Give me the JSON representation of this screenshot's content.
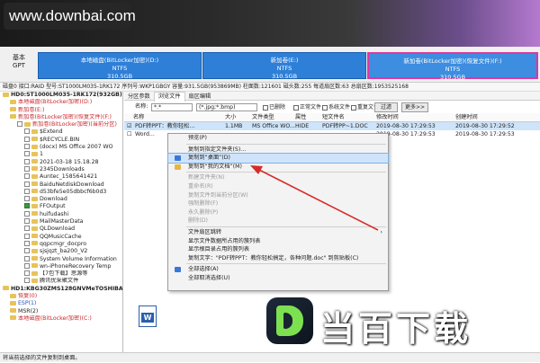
{
  "watermark": "www.downbai.com",
  "disk": {
    "label1": "基本",
    "label2": "GPT",
    "partitions": [
      {
        "name": "本地磁盘(BitLocker加密)(D:)",
        "fs": "NTFS",
        "size": "310.5GB"
      },
      {
        "name": "新加卷(E:)",
        "fs": "NTFS",
        "size": "310.5GB"
      },
      {
        "name": "新加卷(BitLocker加密)(恢复文件)(F:)",
        "fs": "NTFS",
        "size": "310.5GB"
      }
    ]
  },
  "infobar": "磁盘0 接口:RAID  型号:ST1000LM035-1RK172  序列号:WKP1GBGY  容量:931.5GB(953869MB)  柱面数:121601  磁头数:255  每道扇区数:63  总扇区数:1953525168",
  "tree": [
    {
      "text": "HD0:ST1000LM035-1RK172(932GB)",
      "cls": "bold",
      "indent": 0
    },
    {
      "text": "本地磁盘(BitLocker加密)(D:)",
      "cls": "red",
      "indent": 1
    },
    {
      "text": "新加卷(E:)",
      "cls": "red",
      "indent": 1
    },
    {
      "text": "新加卷(BitLocker加密)(恢复文件)(F:)",
      "cls": "red",
      "indent": 1
    },
    {
      "text": "新加卷(BitLocker加密)(当前分区)",
      "cls": "red",
      "indent": 2
    },
    {
      "text": "$Extend",
      "cls": "",
      "indent": 3
    },
    {
      "text": "$RECYCLE.BIN",
      "cls": "",
      "indent": 3
    },
    {
      "text": "(docx) MS Office 2007 WO",
      "cls": "",
      "indent": 3
    },
    {
      "text": "1",
      "cls": "",
      "indent": 3
    },
    {
      "text": "2021-03-18 15.18.28",
      "cls": "",
      "indent": 3
    },
    {
      "text": "2345Downloads",
      "cls": "",
      "indent": 3
    },
    {
      "text": "Auntec_1585641421",
      "cls": "",
      "indent": 3
    },
    {
      "text": "BaiduNetdiskDownload",
      "cls": "",
      "indent": 3
    },
    {
      "text": "d53bfe5e05dbbcf6b0d3",
      "cls": "",
      "indent": 3
    },
    {
      "text": "Download",
      "cls": "",
      "indent": 3
    },
    {
      "text": "FFOutput",
      "cls": "",
      "indent": 3,
      "checked": true
    },
    {
      "text": "huifudashi",
      "cls": "",
      "indent": 3
    },
    {
      "text": "MailMasterData",
      "cls": "",
      "indent": 3
    },
    {
      "text": "QLDownload",
      "cls": "",
      "indent": 3
    },
    {
      "text": "QQMusicCache",
      "cls": "",
      "indent": 3
    },
    {
      "text": "qqpcmgr_docpro",
      "cls": "",
      "indent": 3
    },
    {
      "text": "sjsjqzt_ba200_V2",
      "cls": "",
      "indent": 3
    },
    {
      "text": "System Volume Information",
      "cls": "",
      "indent": 3
    },
    {
      "text": "wn-iPhoneRecovery Temp",
      "cls": "",
      "indent": 3
    },
    {
      "text": "【7包下载】思源等",
      "cls": "",
      "indent": 3
    },
    {
      "text": "腾讯优采聚文件",
      "cls": "",
      "indent": 3
    },
    {
      "text": "HD1:KBG30ZMS128GNVMeTOSHIBA1",
      "cls": "bold",
      "indent": 0
    },
    {
      "text": "恢复(0)",
      "cls": "red",
      "indent": 1
    },
    {
      "text": "ESP(1)",
      "cls": "blue",
      "indent": 1
    },
    {
      "text": "MSR(2)",
      "cls": "",
      "indent": 1
    },
    {
      "text": "本地磁盘(BitLocker加密)(C:)",
      "cls": "red",
      "indent": 1
    }
  ],
  "tabs": [
    "分区参数",
    "浏览文件",
    "扇区编辑"
  ],
  "filter": {
    "name_label": "名称:",
    "name_value": "*.*",
    "type_value": "(*.jpg;*.bmp)",
    "deleted": "已删除",
    "normal": "正常文件",
    "system": "系统文件",
    "dup": "重复文件",
    "filter_btn": "过滤",
    "more_btn": "更多>>"
  },
  "columns": [
    "名称",
    "大小",
    "文件类型",
    "属性",
    "短文件名",
    "修改时间",
    "创建时间"
  ],
  "files": [
    {
      "name": "PDF转PPT：教你轻松...",
      "size": "1.1MB",
      "type": "MS Office WO...",
      "attr": "HIDE",
      "short": "PDF转PP~1.DOC",
      "mtime": "2019-08-30 17:29:53",
      "ctime": "2019-08-30 17:29:52"
    },
    {
      "name": "Word...",
      "size": "",
      "type": "",
      "attr": "",
      "short": "",
      "mtime": "2019-08-30 17:29:53",
      "ctime": "2019-08-30 17:29:53"
    }
  ],
  "menu": [
    {
      "label": "预览(P)",
      "dis": false
    },
    {
      "sep": true
    },
    {
      "label": "复制到指定文件夹(S)...",
      "dis": false
    },
    {
      "label": "复制到“桌面”(D)",
      "dis": false,
      "hl": true,
      "icon": "#3b77d8"
    },
    {
      "label": "复制到“我的文档”(M)",
      "dis": false,
      "icon": "#e6b640"
    },
    {
      "sep": true
    },
    {
      "label": "新建文件夹(N)",
      "dis": true
    },
    {
      "label": "重命名(R)",
      "dis": true
    },
    {
      "label": "复制文件到当前分区(W)",
      "dis": true
    },
    {
      "label": "强制删除(F)",
      "dis": true
    },
    {
      "label": "永久删除(P)",
      "dis": true
    },
    {
      "label": "删除(D)",
      "dis": true
    },
    {
      "sep": true
    },
    {
      "label": "文件扇区跳转",
      "dis": false,
      "arrow": "›"
    },
    {
      "label": "显示文件数据所占用的簇列表",
      "dis": false
    },
    {
      "label": "显示根目录占用的簇列表",
      "dis": false
    },
    {
      "label": "复制文字：\"PDF转PPT：教你轻松搞定，各种问题.doc\" 到剪贴板(C)",
      "dis": false
    },
    {
      "sep": true
    },
    {
      "label": "全部选择(A)",
      "dis": false,
      "icon": "#3b77d8"
    },
    {
      "label": "全部取消选择(U)",
      "dis": false
    }
  ],
  "status": "将当前选择的文件复制到桌面。",
  "brand": "当百下载"
}
